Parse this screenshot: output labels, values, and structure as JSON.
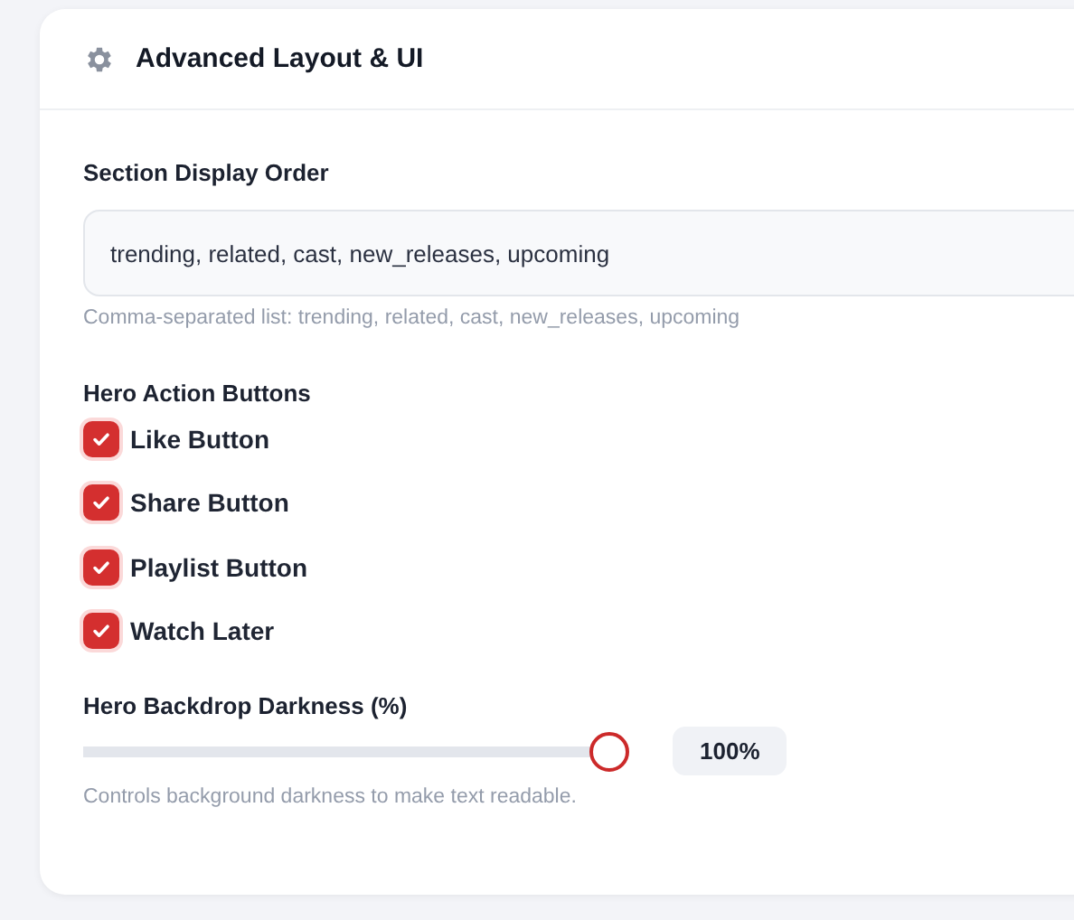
{
  "card": {
    "title": "Advanced Layout & UI"
  },
  "section_order": {
    "label": "Section Display Order",
    "value": "trending, related, cast, new_releases, upcoming",
    "hint": "Comma-separated list: trending, related, cast, new_releases, upcoming"
  },
  "hero_buttons": {
    "label": "Hero Action Buttons",
    "items": [
      {
        "label": "Like Button",
        "checked": true
      },
      {
        "label": "Share Button",
        "checked": true
      },
      {
        "label": "Playlist Button",
        "checked": true
      },
      {
        "label": "Watch Later",
        "checked": true
      }
    ]
  },
  "backdrop": {
    "label": "Hero Backdrop Darkness (%)",
    "level": 1,
    "reading": "100%",
    "hint": "Controls background darkness to make text readable."
  }
}
